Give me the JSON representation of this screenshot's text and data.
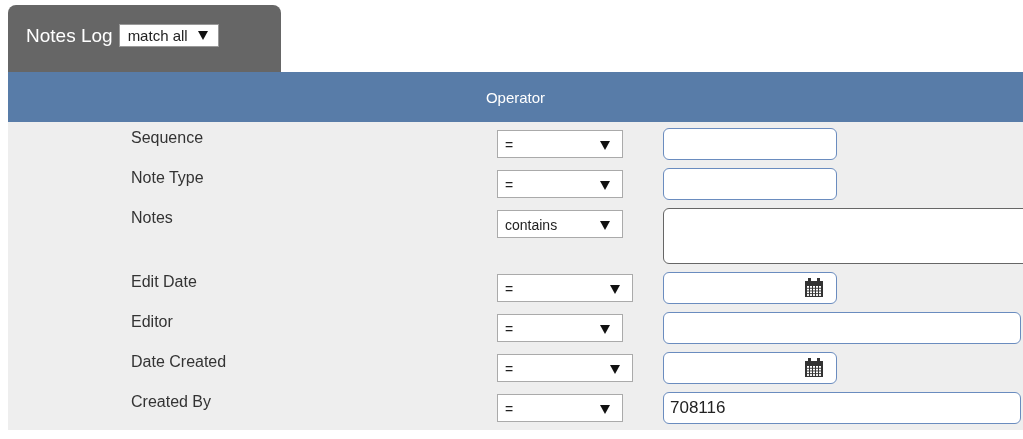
{
  "panel": {
    "title": "Notes Log",
    "match": "match all"
  },
  "header": {
    "title": "Operator"
  },
  "rows": [
    {
      "label": "Sequence",
      "operator": "=",
      "field": {
        "kind": "short"
      }
    },
    {
      "label": "Note Type",
      "operator": "=",
      "field": {
        "kind": "short"
      }
    },
    {
      "label": "Notes",
      "operator": "contains",
      "field": {
        "kind": "textarea"
      }
    },
    {
      "label": "Edit Date",
      "operator": "=",
      "field": {
        "kind": "date"
      }
    },
    {
      "label": "Editor",
      "operator": "=",
      "field": {
        "kind": "long"
      }
    },
    {
      "label": "Date Created",
      "operator": "=",
      "field": {
        "kind": "date"
      }
    },
    {
      "label": "Created By",
      "operator": "=",
      "field": {
        "kind": "long",
        "value": "708116"
      }
    }
  ]
}
